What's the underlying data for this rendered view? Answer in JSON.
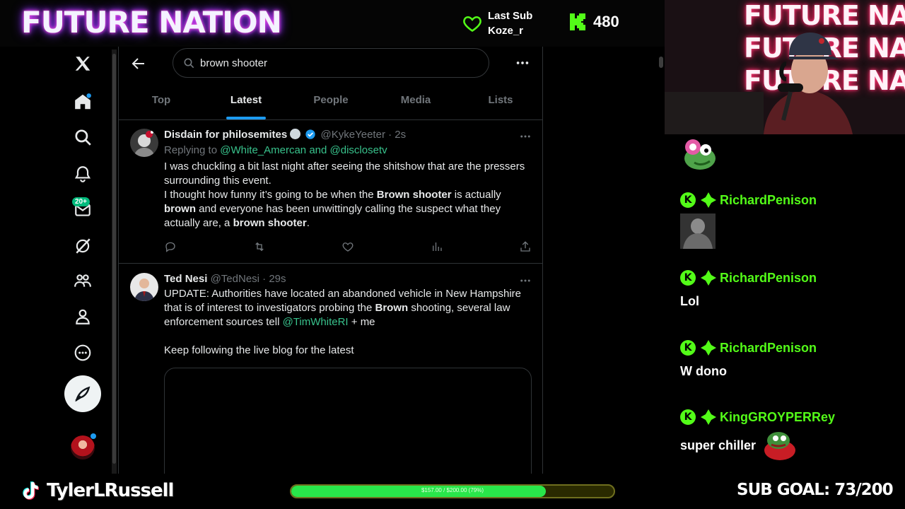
{
  "overlay": {
    "logo": "FUTURE NATION",
    "last_sub_label": "Last Sub",
    "last_sub_user": "Koze_r",
    "kick_count": "480",
    "accent_green": "#53fc18"
  },
  "twitter": {
    "nav_items": [
      "x-logo",
      "home-icon",
      "search-icon",
      "bell-icon",
      "mail-icon",
      "grok-icon",
      "communities-icon",
      "profile-icon",
      "more-circle-icon"
    ],
    "messages_badge": "20+",
    "search": {
      "value": "brown shooter"
    },
    "tabs": [
      {
        "label": "Top"
      },
      {
        "label": "Latest"
      },
      {
        "label": "People"
      },
      {
        "label": "Media"
      },
      {
        "label": "Lists"
      }
    ],
    "active_tab": "Latest",
    "tweets": [
      {
        "name": "Disdain for philosemites",
        "handle": "@KykeYeeter",
        "time": "2s",
        "replying_to_prefix": "Replying to",
        "replying_to_1": "@White_Amercan",
        "replying_to_and": "and",
        "replying_to_2": "@disclosetv",
        "text_1": "I was chuckling a bit last night after seeing the shitshow that are the pressers surrounding this event.",
        "text_2a": "I thought how funny it’s going to be when the ",
        "text_2b": "Brown shooter",
        "text_2c": " is actually ",
        "text_2d": "brown",
        "text_2e": " and everyone has been unwittingly calling the suspect what they actually are, a ",
        "text_2f": "brown shooter",
        "text_2g": "."
      },
      {
        "name": "Ted Nesi",
        "handle": "@TedNesi",
        "time": "29s",
        "text_1a": "UPDATE: Authorities have located an abandoned vehicle in New Hampshire that is of interest to investigators probing the ",
        "text_1b": "Brown",
        "text_1c": " shooting, several law enforcement sources tell ",
        "text_1d": "@TimWhiteRI",
        "text_1e": " + me",
        "text_2": "Keep following the live blog for the latest"
      }
    ]
  },
  "webcam": {
    "sign_lines": [
      "FUTURE NATION",
      "FUTURE NATION",
      "FUTURE NATION"
    ]
  },
  "chat": {
    "messages": [
      {
        "user": "RichardPenison",
        "text": ""
      },
      {
        "user": "RichardPenison",
        "text": "Lol"
      },
      {
        "user": "RichardPenison",
        "text": "W dono"
      },
      {
        "user": "KingGROYPERRey",
        "text": "super chiller"
      }
    ]
  },
  "bottom": {
    "streamer": "TylerLRussell",
    "goal_label": "$157.00 / $200.00 (79%)",
    "goal_fraction": 0.79,
    "sub_goal": "SUB GOAL: 73/200"
  }
}
